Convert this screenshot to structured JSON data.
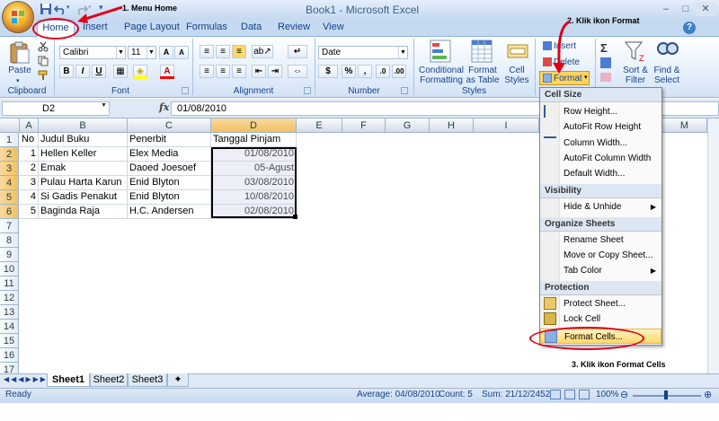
{
  "window": {
    "title": "Book1 - Microsoft Excel",
    "min": "–",
    "max": "□",
    "close": "✕"
  },
  "tabs": [
    "Home",
    "Insert",
    "Page Layout",
    "Formulas",
    "Data",
    "Review",
    "View"
  ],
  "ribbon": {
    "clipboard": {
      "paste": "Paste",
      "label": "Clipboard"
    },
    "font": {
      "name": "Calibri",
      "size": "11",
      "bold": "B",
      "italic": "I",
      "underline": "U",
      "label": "Font"
    },
    "alignment": {
      "label": "Alignment"
    },
    "number": {
      "format": "Date",
      "label": "Number"
    },
    "styles": {
      "conditional": "Conditional Formatting",
      "table": "Format as Table",
      "cell": "Cell Styles",
      "label": "Styles"
    },
    "cells": {
      "insert": "Insert",
      "delete": "Delete",
      "format": "Format"
    },
    "editing": {
      "sort": "Sort & Filter",
      "find": "Find & Select"
    }
  },
  "formula": {
    "namebox": "D2",
    "fx": "fx",
    "value": "01/08/2010"
  },
  "columns": [
    "A",
    "B",
    "C",
    "D",
    "E",
    "F",
    "G",
    "H",
    "I",
    "M"
  ],
  "rows": [
    [
      "No",
      "Judul Buku",
      "Penerbit",
      "Tanggal Pinjam"
    ],
    [
      "1",
      "Hellen Keller",
      "Elex Media",
      "01/08/2010"
    ],
    [
      "2",
      "Emak",
      "Daoed Joesoef",
      "05-Agust"
    ],
    [
      "3",
      "Pulau Harta Karun",
      "Enid Blyton",
      "03/08/2010"
    ],
    [
      "4",
      "Si Gadis Penakut",
      "Enid Blyton",
      "10/08/2010"
    ],
    [
      "5",
      "Baginda Raja",
      "H.C. Andersen",
      "02/08/2010"
    ]
  ],
  "row_numbers": [
    "1",
    "2",
    "3",
    "4",
    "5",
    "6",
    "7",
    "8",
    "9",
    "10",
    "11",
    "12",
    "13",
    "14",
    "15",
    "16",
    "17"
  ],
  "sheets": [
    "Sheet1",
    "Sheet2",
    "Sheet3"
  ],
  "status": {
    "ready": "Ready",
    "average": "Average: 04/08/2010",
    "count": "Count: 5",
    "sum": "Sum: 21/12/2452",
    "zoom": "100%"
  },
  "menu": {
    "cell_size": "Cell Size",
    "row_height": "Row Height...",
    "autofit_row": "AutoFit Row Height",
    "column_width": "Column Width...",
    "autofit_col": "AutoFit Column Width",
    "default_width": "Default Width...",
    "visibility": "Visibility",
    "hide_unhide": "Hide & Unhide",
    "organize": "Organize Sheets",
    "rename": "Rename Sheet",
    "move_copy": "Move or Copy Sheet...",
    "tab_color": "Tab Color",
    "protection": "Protection",
    "protect_sheet": "Protect Sheet...",
    "lock_cell": "Lock Cell",
    "format_cells": "Format Cells..."
  },
  "annotations": {
    "a1": "1. Menu Home",
    "a2": "2. Klik ikon Format",
    "a3": "3. Klik ikon Format Cells"
  },
  "colors": {
    "accent": "#15428b",
    "annotation": "#e0001b",
    "selection": "#e6e9f4"
  }
}
